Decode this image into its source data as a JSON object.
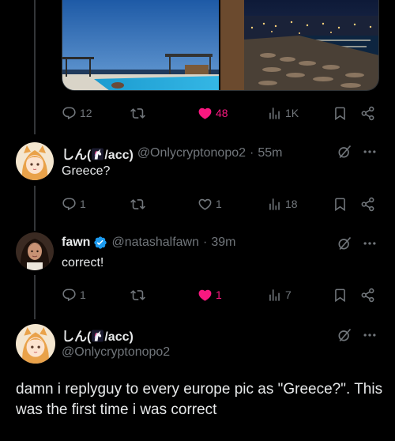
{
  "original_post": {
    "photos": [
      "poolside-terrace-photo",
      "beach-at-night-photo"
    ],
    "replies": "12",
    "reposts": "",
    "likes": "48",
    "views": "1K"
  },
  "reply_1": {
    "name": "しん(",
    "name_suffix": "/acc)",
    "handle": "@Onlycryptonopo2",
    "separator": "·",
    "time": "55m",
    "text": "Greece?",
    "replies": "1",
    "reposts": "",
    "likes": "1",
    "views": "18"
  },
  "reply_2": {
    "name": "fawn",
    "verified": true,
    "handle": "@natashalfawn",
    "separator": "·",
    "time": "39m",
    "text": "correct!",
    "replies": "1",
    "reposts": "",
    "likes": "1",
    "liked": true,
    "views": "7"
  },
  "focused_post": {
    "name": "しん(",
    "name_suffix": "/acc)",
    "handle": "@Onlycryptonopo2",
    "text": "damn i replyguy to every europe pic as \"Greece?\". This was the first time i was correct"
  },
  "icons": {
    "reply": "reply-icon",
    "repost": "repost-icon",
    "like": "heart-icon",
    "views": "views-icon",
    "bookmark": "bookmark-icon",
    "share": "share-icon",
    "grok": "grok-icon",
    "more": "more-icon",
    "verified": "verified-badge-icon",
    "unicorn": "unicorn-emoji"
  },
  "colors": {
    "background": "#000000",
    "text": "#e7e9ea",
    "muted": "#71767b",
    "like": "#f91880",
    "verified": "#1d9bf0"
  }
}
